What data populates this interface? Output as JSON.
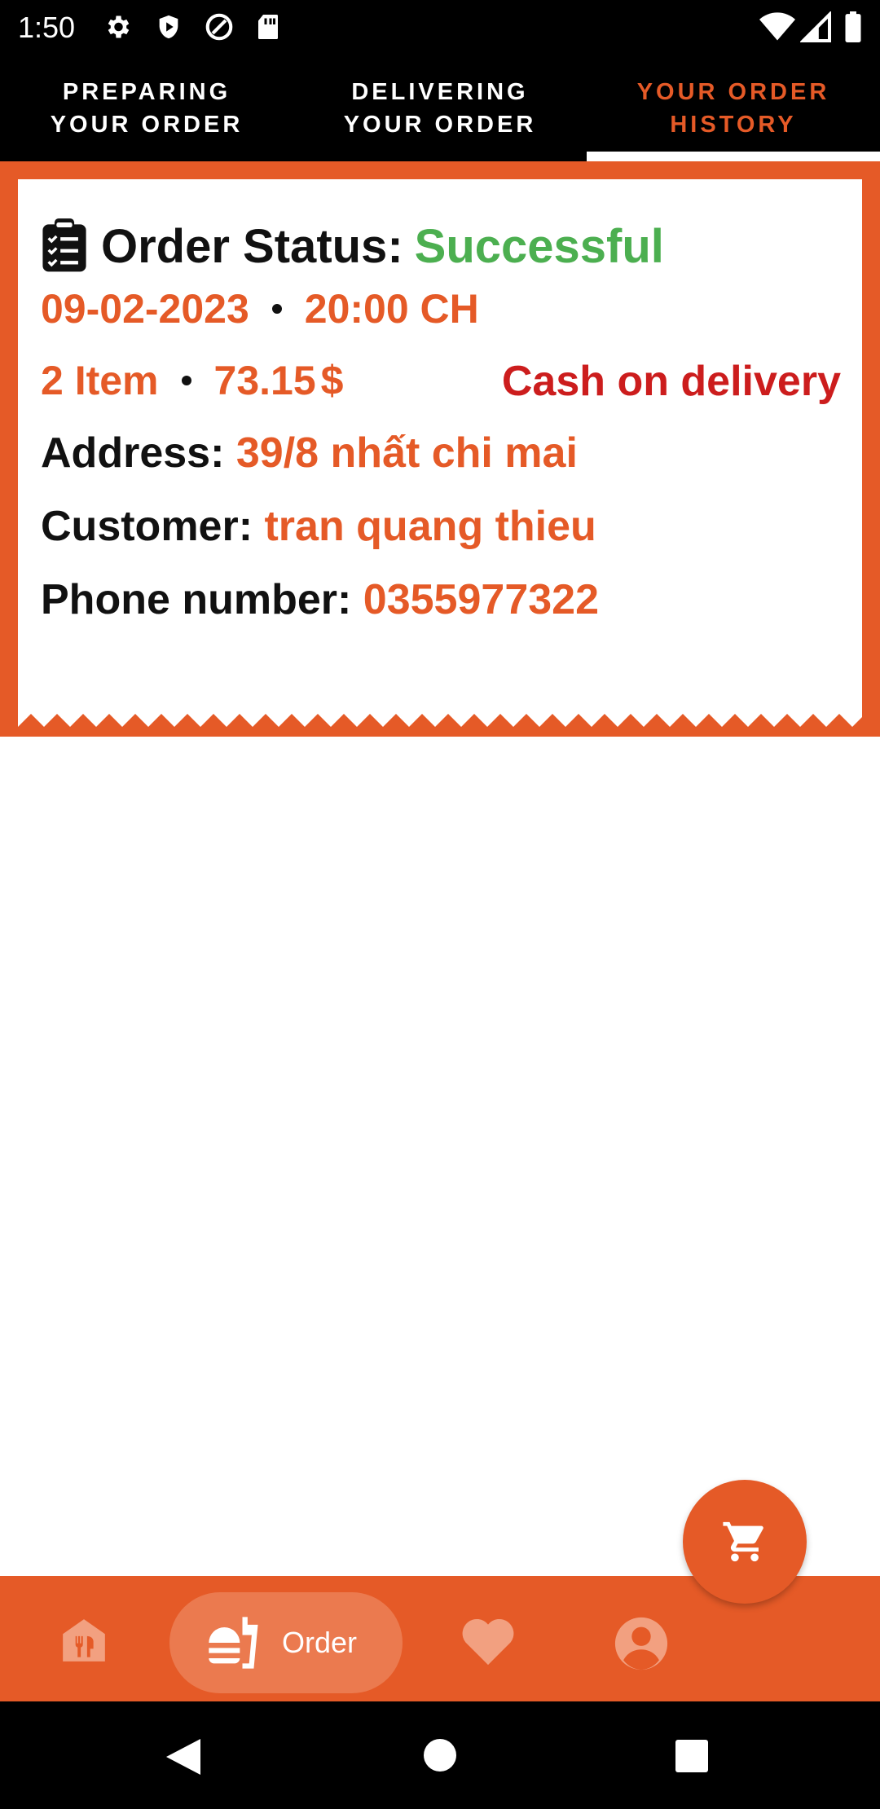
{
  "status_bar": {
    "time": "1:50",
    "left_icons": [
      "settings-icon",
      "shield-icon",
      "at-sign-icon",
      "sd-card-icon"
    ],
    "right_icons": [
      "wifi-icon",
      "cell-signal-icon",
      "battery-icon"
    ]
  },
  "tabs": [
    {
      "label": "PREPARING\nYOUR ORDER",
      "active": false
    },
    {
      "label": "DELIVERING\nYOUR ORDER",
      "active": false
    },
    {
      "label": "YOUR ORDER\nHISTORY",
      "active": true
    }
  ],
  "order": {
    "status_label": "Order Status:",
    "status_value": "Successful",
    "date": "09-02-2023",
    "time": "20:00 CH",
    "items": "2 Item",
    "price": "73.15",
    "currency": "$",
    "payment": "Cash on delivery",
    "address_label": "Address:",
    "address_value": "39/8 nhất chi mai",
    "customer_label": "Customer:",
    "customer_value": "tran quang thieu",
    "phone_label": "Phone number:",
    "phone_value": "0355977322"
  },
  "bottom_nav": {
    "items": [
      "home-icon",
      "order",
      "favorites-icon",
      "profile-icon"
    ],
    "order_label": "Order"
  },
  "colors": {
    "accent": "#e55a27",
    "success": "#4caf50",
    "payment": "#cc1d1d"
  }
}
